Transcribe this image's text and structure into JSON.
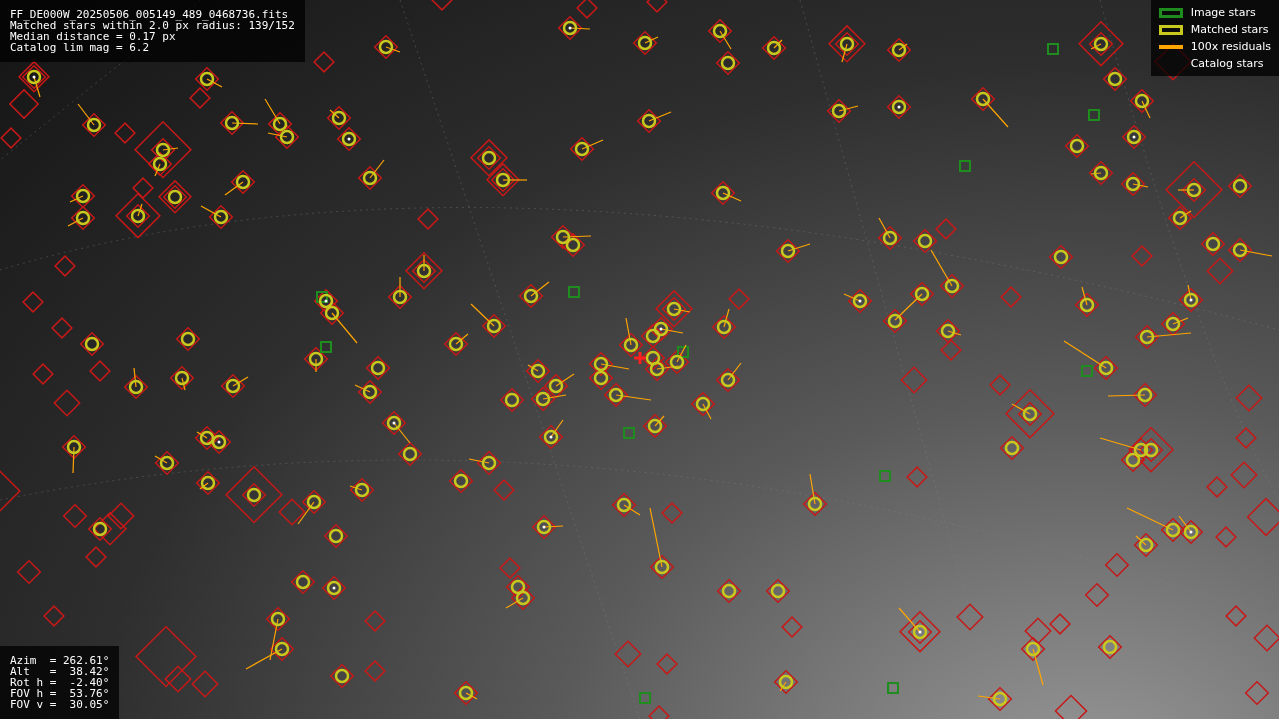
{
  "info_panel": {
    "lines": [
      "FF_DE000W_20250506_005149_489_0468736.fits",
      "Matched stars within 2.0 px radius: 139/152",
      "Median distance = 0.17 px",
      "Catalog lim mag = 6.2"
    ]
  },
  "legend": {
    "items": [
      {
        "label": "Image stars",
        "kind": "box",
        "color": "#1e8c1e"
      },
      {
        "label": "Matched stars",
        "kind": "box",
        "color": "#c8c81e"
      },
      {
        "label": "100x residuals",
        "kind": "line",
        "color": "#ffa500"
      },
      {
        "label": "Catalog stars",
        "kind": "none"
      }
    ]
  },
  "pointing_panel": {
    "lines": [
      "Azim  = 262.61°",
      "Alt   =  38.42°",
      "Rot h =  -2.40°",
      "FOV h =  53.76°",
      "FOV v =  30.05°"
    ]
  }
}
